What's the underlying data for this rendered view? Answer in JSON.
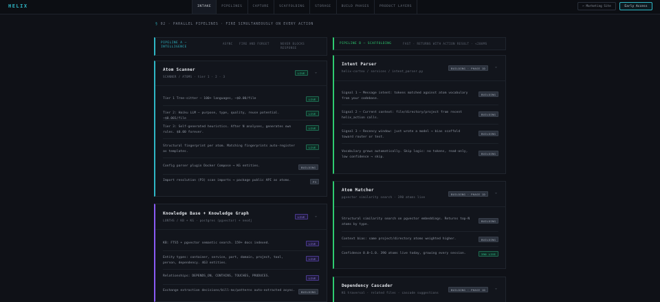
{
  "app": {
    "logo": "HELIX"
  },
  "nav": {
    "items": [
      {
        "label": "INTAKE",
        "active": true
      },
      {
        "label": "PIPELINES",
        "active": false
      },
      {
        "label": "CAPTURE",
        "active": false
      },
      {
        "label": "SCAFFOLDING",
        "active": false
      },
      {
        "label": "STORAGE",
        "active": false
      },
      {
        "label": "BUILD PHASES",
        "active": false
      },
      {
        "label": "PRODUCT LAYERS",
        "active": false
      }
    ],
    "marketing_label": "← Marketing Site",
    "early_access_label": "Early Access"
  },
  "section": {
    "symbol": "§",
    "title": "02 · PARALLEL PIPELINES · FIRE SIMULTANEOUSLY ON EVERY ACTION"
  },
  "pipeline_a": {
    "title": "PIPELINE A — INTELLIGENCE",
    "tags": [
      "ASYNC",
      "FIRE AND FORGET",
      "NEVER BLOCKS RESPONSE"
    ]
  },
  "pipeline_b": {
    "title": "PIPELINE B — SCAFFOLDING",
    "tags": [
      "FAST · RETURNS WITH ACTION RESULT · <200MS"
    ]
  },
  "atom_scanner": {
    "title": "Atom Scanner",
    "subtitle": "SCANNER / ATOMS · tier 1 · 2 · 3",
    "badge": "LIVE",
    "rows": [
      {
        "text": "Tier 1 Tree-sitter — 100+ languages, ~$0.00/file",
        "badge": "LIVE"
      },
      {
        "text": "Tier 2: Haiku LLM — purpose, type, quality, reuse potential. ~$0.001/file",
        "badge": "LIVE"
      },
      {
        "text": "Tier 3: Self-generated heuristics. After N analyses, generates own rules. $0.00 forever.",
        "badge": "LIVE"
      },
      {
        "text": "Structural fingerprint per atom. Matching fingerprints auto-register as templates.",
        "badge": "LIVE"
      },
      {
        "text": "Config parser plugin Docker Compose → KG entities.",
        "badge": "BUILDING"
      },
      {
        "text": "Import resolution (P3) scan imports → package public API as atoms.",
        "badge": "P3"
      }
    ]
  },
  "knowledge_base": {
    "title": "Knowledge Base + Knowledge Graph",
    "subtitle": "LONTHS / KB + KG · postgres (pgvector) + neo4j",
    "badge": "LIVE",
    "rows": [
      {
        "text": "KB: FTS5 + pgvector semantic search. 159+ docs indexed.",
        "badge": "LIVE"
      },
      {
        "text": "Entity types: container, service, port, domain, project, tool, person, dependency. 463 entities.",
        "badge": "LIVE"
      },
      {
        "text": "Relationships: DEPENDS_ON, CONTAINS, TOUCHES, PRODUCES.",
        "badge": "LIVE"
      },
      {
        "text": "Exchange extraction decisions/bill-ms/patterns auto-extracted async.",
        "badge": "BUILDING"
      }
    ]
  },
  "intent_parser": {
    "title": "Intent Parser",
    "subtitle": "helix-cortex / services / intent_parser.py",
    "badge": "BUILDING · PHASE 1D",
    "rows": [
      {
        "text": "Signal 1 — Message intent: tokens matched against atom vocabulary from your codebase.",
        "badge": "BUILDING"
      },
      {
        "text": "Signal 2 — Current context: file/directory/project from recent helix_action calls.",
        "badge": "BUILDING"
      },
      {
        "text": "Signal 3 — Recency window: just wrote a model → bias scaffold toward router or test.",
        "badge": "BUILDING"
      },
      {
        "text": "Vocabulary grows automatically. Skip logic: no tokens, read-only, low confidence → skip.",
        "badge": "BUILDING"
      }
    ]
  },
  "atom_matcher": {
    "title": "Atom Matcher",
    "subtitle": "pgvector similarity search · 390 atoms live",
    "badge": "BUILDING · PHASE 1D",
    "rows": [
      {
        "text": "Structural similarity search on pgvector embeddings. Returns top-N atoms by type.",
        "badge": "BUILDING"
      },
      {
        "text": "Context bias: same project/directory atoms weighted higher.",
        "badge": "BUILDING"
      },
      {
        "text": "Confidence 0.0–1.0. 390 atoms live today, growing every session.",
        "badge": "390 LIVE"
      }
    ]
  },
  "dependency_cascader": {
    "title": "Dependency Cascader",
    "subtitle": "KG traversal · related files · cascade suggestions",
    "badge": "BUILDING · PHASE 1D"
  },
  "colors": {
    "cyan": "#2fb8c7",
    "green": "#2ecc71",
    "purple": "#8b5cf6",
    "bg": "#0f1117"
  },
  "icons": {
    "chevron": "chevron-down-icon"
  }
}
